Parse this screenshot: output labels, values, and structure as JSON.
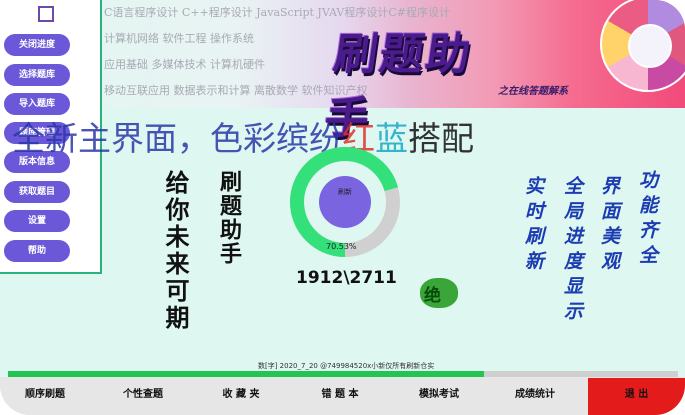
{
  "topbar": {
    "topic_rows": [
      "C语言程序设计 C++程序设计 JavaScript JVAV程序设计C#程序设计",
      "计算机网络 软件工程 操作系统",
      "应用基础 多媒体技术 计算机硬件",
      "移动互联应用 数据表示和计算 离散数学 软件知识产权"
    ],
    "logo_text": "刷题助手",
    "logo_subtitle": "之在线答题解系"
  },
  "sidebar": {
    "items": [
      {
        "label": "关闭进度"
      },
      {
        "label": "选择题库"
      },
      {
        "label": "导入题库"
      },
      {
        "label": "题库管理"
      },
      {
        "label": "版本信息"
      },
      {
        "label": "获取题目"
      },
      {
        "label": "设置"
      },
      {
        "label": "帮助"
      }
    ]
  },
  "headline": {
    "part1": "全新主界面，色彩缤纷",
    "red": "红",
    "cyan": "蓝",
    "part2": "搭配"
  },
  "slogans": {
    "future": "给你未来可期",
    "app": "刷题助手"
  },
  "progress_ring": {
    "center_label": "刷新",
    "percent_text": "70.53%",
    "fraction": 0.7053,
    "count_text": "1912\\2711",
    "ring_color": "#33e07a",
    "track_color": "#d0d0d0",
    "center_color": "#7b64e0"
  },
  "badge": {
    "text": "绝"
  },
  "features": [
    "实时刷新",
    "全局进度显示",
    "界面美观",
    "功能齐全"
  ],
  "footer": {
    "credit": "数[字] 2020_7_20 @749984520x小新仅所有刷新仓实",
    "progress_fraction": 0.71
  },
  "bottom_nav": {
    "items": [
      {
        "label": "顺序刷题"
      },
      {
        "label": "个性查题"
      },
      {
        "label": "收 藏 夹"
      },
      {
        "label": "错 题 本"
      },
      {
        "label": "模拟考试"
      },
      {
        "label": "成绩统计"
      }
    ],
    "exit_label": "退 出",
    "exit_color": "#e31b1b"
  }
}
